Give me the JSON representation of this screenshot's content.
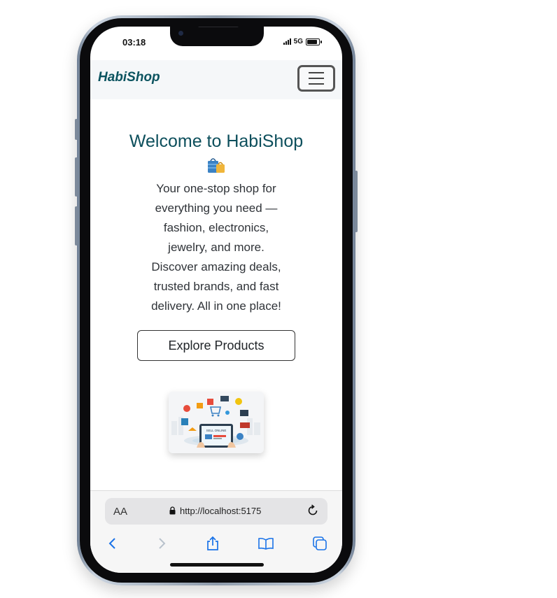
{
  "status_bar": {
    "time": "03:18",
    "network": "5G"
  },
  "navbar": {
    "brand": "HabiShop",
    "menu_icon": "hamburger-icon"
  },
  "hero": {
    "title": "Welcome to HabiShop",
    "title_icon": "shopping-bags-emoji",
    "description": "Your one-stop shop for everything you need — fashion, electronics, jewelry, and more. Discover amazing deals, trusted brands, and fast delivery. All in one place!",
    "cta_label": "Explore Products",
    "image_label": "SELL ONLINE"
  },
  "browser": {
    "text_size_label": "AA",
    "url": "http://localhost:5175",
    "toolbar_icons": [
      "back-icon",
      "forward-icon",
      "share-icon",
      "bookmarks-icon",
      "tabs-icon"
    ]
  },
  "colors": {
    "brand": "#0c5460",
    "title": "#0d4f5c",
    "safari_blue": "#1a73e8"
  }
}
